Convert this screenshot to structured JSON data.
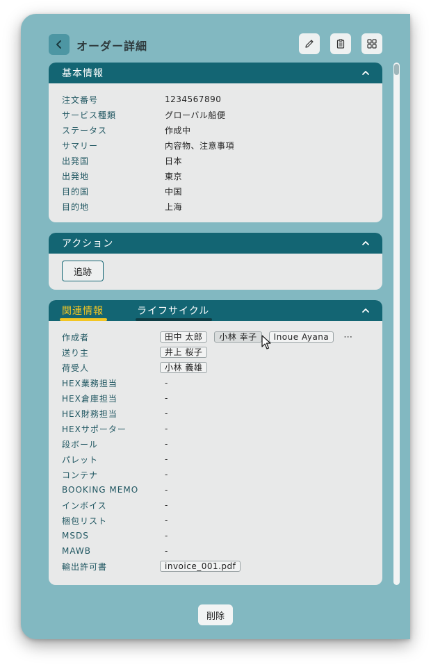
{
  "header": {
    "title": "オーダー詳細",
    "back_icon": "chevron-left-icon",
    "tools": [
      "pencil-icon",
      "clipboard-icon",
      "grid-icon"
    ]
  },
  "basic_info": {
    "title": "基本情報",
    "rows": [
      {
        "label": "注文番号",
        "value": "1234567890"
      },
      {
        "label": "サービス種類",
        "value": "グローバル船便"
      },
      {
        "label": "ステータス",
        "value": "作成中"
      },
      {
        "label": "サマリー",
        "value": "内容物、注意事項"
      },
      {
        "label": "出発国",
        "value": "日本"
      },
      {
        "label": "出発地",
        "value": "東京"
      },
      {
        "label": "目的国",
        "value": "中国"
      },
      {
        "label": "目的地",
        "value": "上海"
      }
    ]
  },
  "actions": {
    "title": "アクション",
    "track_label": "追跡"
  },
  "related": {
    "tab_active": "関連情報",
    "tab_inactive": "ライフサイクル",
    "creator": {
      "label": "作成者",
      "chips": [
        "田中 太郎",
        "小林 幸子",
        "Inoue Ayana"
      ],
      "more": "⋯"
    },
    "sender": {
      "label": "送り主",
      "chip": "井上 桜子"
    },
    "receiver": {
      "label": "荷受人",
      "chip": "小林 義雄"
    },
    "rows": [
      {
        "label": "HEX業務担当",
        "value": "-"
      },
      {
        "label": "HEX倉庫担当",
        "value": "-"
      },
      {
        "label": "HEX財務担当",
        "value": "-"
      },
      {
        "label": "HEXサポーター",
        "value": "-"
      },
      {
        "label": "段ボール",
        "value": "-"
      },
      {
        "label": "パレット",
        "value": "-"
      },
      {
        "label": "コンテナ",
        "value": "-"
      },
      {
        "label": "BOOKING MEMO",
        "value": "-"
      },
      {
        "label": "インボイス",
        "value": "-"
      },
      {
        "label": "梱包リスト",
        "value": "-"
      },
      {
        "label": "MSDS",
        "value": "-"
      },
      {
        "label": "MAWB",
        "value": "-"
      }
    ],
    "export": {
      "label": "輸出許可書",
      "chip": "invoice_001.pdf"
    }
  },
  "footer": {
    "delete_label": "削除"
  },
  "colors": {
    "background": "#82b8c1",
    "panel_header": "#136573",
    "panel_body": "#e8e9e9",
    "active_tab": "#f3c623",
    "label_text": "#1e5560"
  }
}
